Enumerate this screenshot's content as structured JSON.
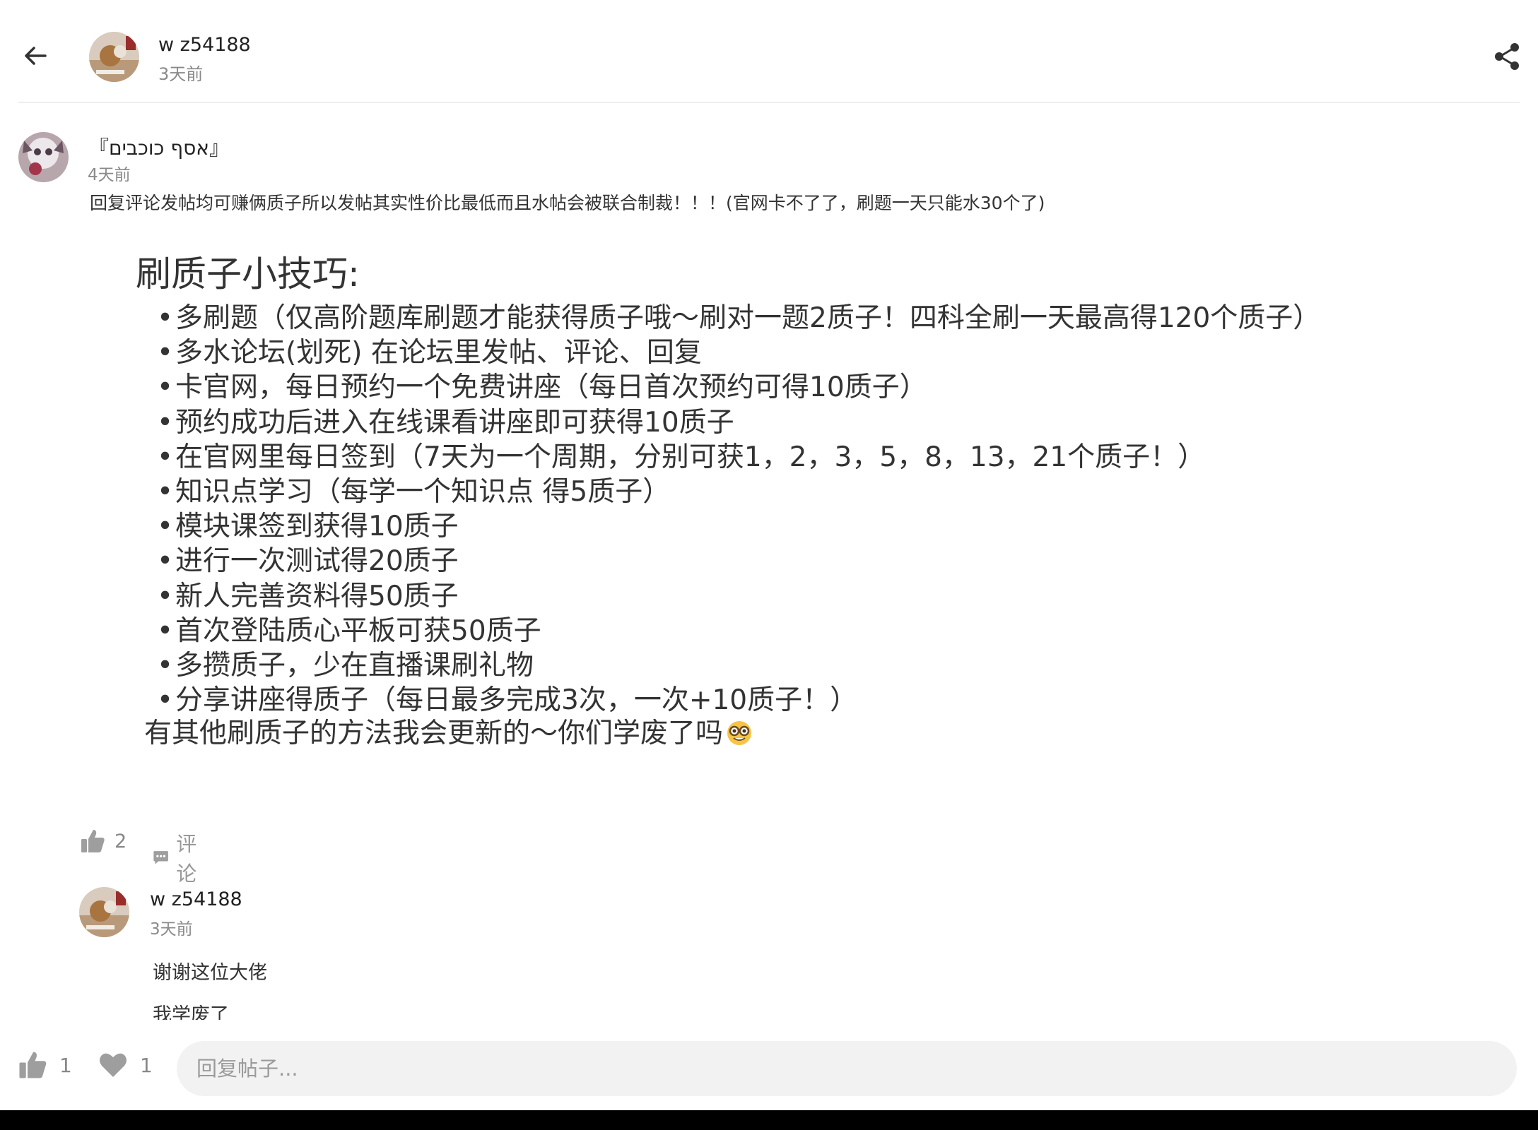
{
  "header": {
    "username": "w z54188",
    "time": "3天前"
  },
  "post": {
    "author": "『אסף כוכבים』",
    "time": "4天前",
    "text": "回复评论发帖均可赚俩质子所以发帖其实性价比最低而且水帖会被联合制裁！！！(官网卡不了了，刷题一天只能水30个了)",
    "image": {
      "title": "刷质子小技巧:",
      "bullet": "•",
      "items": [
        "多刷题（仅高阶题库刷题才能获得质子哦～刷对一题2质子！四科全刷一天最高得120个质子）",
        "多水论坛(划死) 在论坛里发帖、评论、回复",
        "卡官网，每日预约一个免费讲座（每日首次预约可得10质子）",
        "预约成功后进入在线课看讲座即可获得10质子",
        "在官网里每日签到（7天为一个周期，分别可获1，2，3，5，8，13，21个质子！）",
        "知识点学习（每学一个知识点 得5质子）",
        "模块课签到获得10质子",
        "进行一次测试得20质子",
        "新人完善资料得50质子",
        "首次登陆质心平板可获50质子",
        "多攒质子，少在直播课刷礼物",
        "分享讲座得质子（每日最多完成3次，一次+10质子！）"
      ],
      "footer": "有其他刷质子的方法我会更新的～你们学废了吗"
    },
    "likes": "2",
    "comment_label": "评论"
  },
  "comment": {
    "username": "w z54188",
    "time": "3天前",
    "lines": [
      "谢谢这位大佬",
      "我学废了"
    ]
  },
  "bottom_bar": {
    "likes": "1",
    "favorites": "1",
    "reply_placeholder": "回复帖子..."
  },
  "icons": {
    "back": "arrow-left-icon",
    "share": "share-icon",
    "like": "thumbs-up-icon",
    "comment": "comment-bubble-icon",
    "favorite": "heart-icon",
    "emoji": "nerd-face-emoji"
  },
  "colors": {
    "text_primary": "#222222",
    "text_secondary": "#8a8a8a",
    "icon_gray": "#9e9e9e",
    "input_background": "#f2f2f2",
    "divider": "#eeeeee"
  }
}
